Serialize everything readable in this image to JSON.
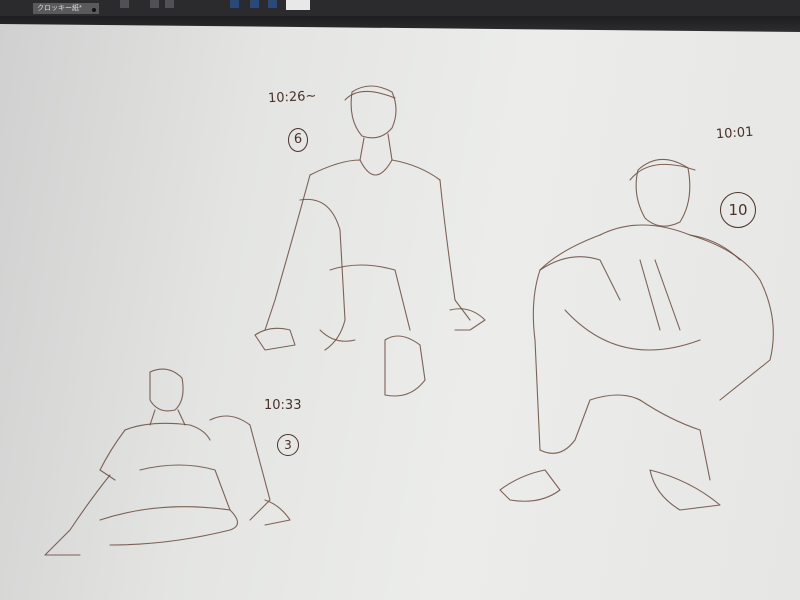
{
  "app": {
    "document_tab": "クロッキー紙*"
  },
  "sketches": [
    {
      "time_label": "10:26~",
      "minutes_label": "6"
    },
    {
      "time_label": "10:01",
      "minutes_label": "10"
    },
    {
      "time_label": "10:33",
      "minutes_label": "3"
    }
  ]
}
